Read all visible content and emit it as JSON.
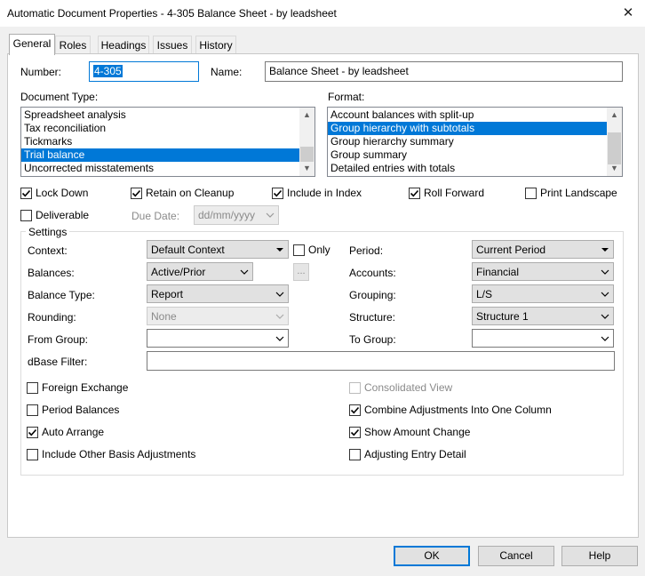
{
  "window": {
    "title": "Automatic Document Properties - 4-305 Balance Sheet - by leadsheet"
  },
  "tabs": [
    "General",
    "Roles",
    "Headings",
    "Issues",
    "History"
  ],
  "general": {
    "number_label": "Number:",
    "number_value": "4-305",
    "name_label": "Name:",
    "name_value": "Balance Sheet - by leadsheet",
    "doc_type_label": "Document Type:",
    "doc_types": [
      "Spreadsheet analysis",
      "Tax reconciliation",
      "Tickmarks",
      "Trial balance",
      "Uncorrected misstatements"
    ],
    "doc_type_selected": "Trial balance",
    "format_label": "Format:",
    "formats": [
      "Account balances with split-up",
      "Group hierarchy with subtotals",
      "Group hierarchy summary",
      "Group summary",
      "Detailed entries with totals"
    ],
    "format_selected": "Group hierarchy with subtotals",
    "flags": {
      "lock_down": "Lock Down",
      "retain_on_cleanup": "Retain on Cleanup",
      "include_in_index": "Include in Index",
      "roll_forward": "Roll Forward",
      "print_landscape": "Print Landscape",
      "deliverable": "Deliverable"
    },
    "due_date_label": "Due Date:",
    "due_date_value": "dd/mm/yyyy"
  },
  "settings": {
    "caption": "Settings",
    "context_label": "Context:",
    "context_value": "Default Context",
    "only_label": "Only",
    "period_label": "Period:",
    "period_value": "Current Period",
    "balances_label": "Balances:",
    "balances_value": "Active/Prior",
    "ellipsis": "...",
    "accounts_label": "Accounts:",
    "accounts_value": "Financial",
    "balance_type_label": "Balance Type:",
    "balance_type_value": "Report",
    "grouping_label": "Grouping:",
    "grouping_value": "L/S",
    "rounding_label": "Rounding:",
    "rounding_value": "None",
    "structure_label": "Structure:",
    "structure_value": "Structure 1",
    "from_group_label": "From Group:",
    "from_group_value": "",
    "to_group_label": "To Group:",
    "to_group_value": "",
    "dbase_filter_label": "dBase Filter:",
    "dbase_filter_value": "",
    "options": {
      "foreign_exchange": "Foreign Exchange",
      "period_balances": "Period Balances",
      "auto_arrange": "Auto Arrange",
      "include_other_basis": "Include Other Basis Adjustments",
      "consolidated_view": "Consolidated View",
      "combine_adjustments": "Combine Adjustments Into One Column",
      "show_amount_change": "Show Amount Change",
      "adjusting_entry_detail": "Adjusting Entry Detail"
    }
  },
  "buttons": {
    "ok": "OK",
    "cancel": "Cancel",
    "help": "Help"
  },
  "colors": {
    "accent": "#0078d7",
    "dialog_bg": "#f0f0f0"
  }
}
